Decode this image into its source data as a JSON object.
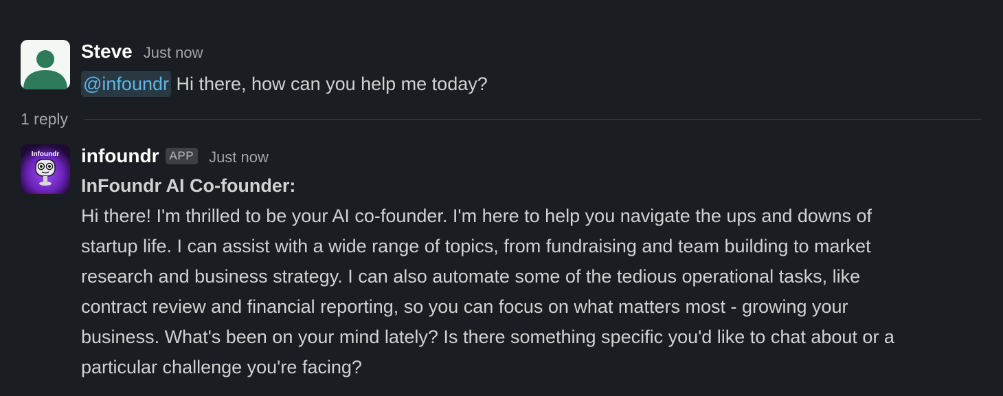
{
  "messages": [
    {
      "author": "Steve",
      "timestamp": "Just now",
      "avatar_icon": "default-user-icon",
      "mention": "@infoundr",
      "text": " Hi there, how can you help me today?"
    },
    {
      "author": "infoundr",
      "badge": "APP",
      "timestamp": "Just now",
      "avatar_icon": "infoundr-robot-logo",
      "avatar_logo_text": "Infoundr",
      "heading": "InFoundr AI Co-founder:",
      "body_lines": [
        "Hi there! I'm thrilled to be your AI co-founder. I'm here to help you navigate the ups and downs of",
        "startup life. I can assist with a wide range of topics, from fundraising and team building to market",
        "research and business strategy. I can also automate some of the tedious operational tasks, like",
        "contract review and financial reporting, so you can focus on what matters most - growing your",
        "business. What's been on your mind lately? Is there something specific you'd like to chat about or a",
        "particular challenge you're facing?"
      ]
    }
  ],
  "thread": {
    "reply_count": "1 reply"
  },
  "colors": {
    "background": "#1a1d21",
    "text": "#d1d2d3",
    "mention": "#5fb4e4",
    "avatar_green": "#2f7a5a",
    "bot_purple": "#7a36c8"
  }
}
